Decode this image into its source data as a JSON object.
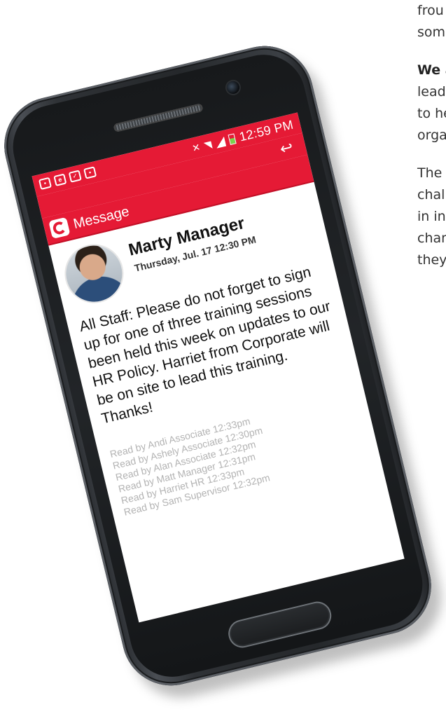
{
  "background_text": {
    "lines": [
      {
        "text": "frou",
        "bold": false
      },
      {
        "text": "some",
        "bold": false
      },
      {
        "text": "",
        "gap": true
      },
      {
        "text": "We a",
        "bold": true
      },
      {
        "text": "leade",
        "bold": false
      },
      {
        "text": "to he",
        "bold": false
      },
      {
        "text": "orga",
        "bold": false
      },
      {
        "text": "",
        "gap": true
      },
      {
        "text": "The t",
        "bold": false
      },
      {
        "text": "chall",
        "bold": false
      },
      {
        "text": "in int",
        "bold": false
      },
      {
        "text": "chan",
        "bold": false
      },
      {
        "text": "they",
        "bold": false
      }
    ]
  },
  "status_bar": {
    "time": "12:59 PM",
    "left_icons": [
      "picture-icon",
      "e-icon",
      "bag-icon",
      "bag-icon"
    ]
  },
  "app_bar": {
    "title": "Message",
    "back_icon": "reply-arrow-icon"
  },
  "message": {
    "sender": "Marty Manager",
    "date": "Thursday, Jul. 17 12:30 PM",
    "body": "All Staff: Please do not forget to sign up for one of three training sessions been held this week on updates to our HR Policy. Harriet from Corporate will be on site to lead this training. Thanks!",
    "read_receipts": [
      "Read by Andi Associate 12:33pm",
      "Read by Ashely Associate 12:30pm",
      "Read by Alan Associate 12:32pm",
      "Read by Matt Manager 12:31pm",
      "Read by Harriet HR 12:33pm",
      "Read by Sam Supervisor 12:32pm"
    ]
  },
  "colors": {
    "brand_red": "#e51a35",
    "read_text": "#b3b3b3"
  }
}
